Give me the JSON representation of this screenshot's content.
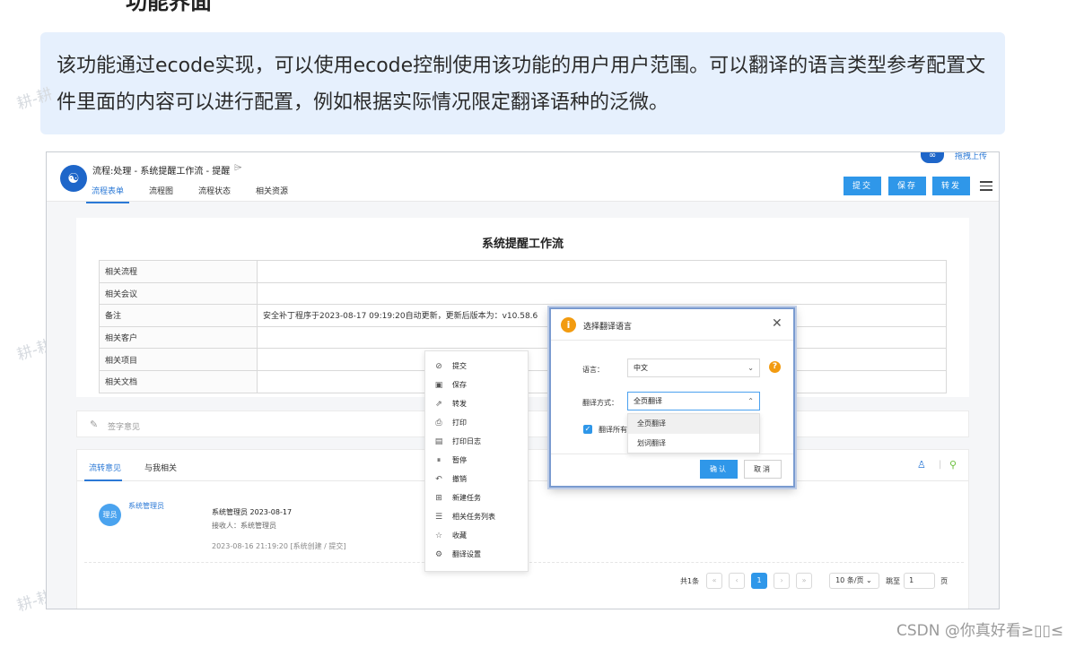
{
  "doc": {
    "heading_clip": "功能界面",
    "callout": "该功能通过ecode实现，可以使用ecode控制使用该功能的用户用户范围。可以翻译的语言类型参考配置文件里面的内容可以进行配置，例如根据实际情况限定翻译语种的泛微。",
    "watermark": "耕-耕",
    "csdn_credit": "CSDN @你真好看≥▯▯≤"
  },
  "header": {
    "logo": "☯",
    "title": "流程:处理 - 系统提醒工作流 - 提醒",
    "tag_icon": "⌲",
    "upload_icon": "∞",
    "upload_text": "拖拽上传",
    "tabs": [
      {
        "label": "流程表单"
      },
      {
        "label": "流程图"
      },
      {
        "label": "流程状态"
      },
      {
        "label": "相关资源"
      }
    ],
    "buttons": {
      "submit": "提交",
      "save": "保存",
      "forward": "转发"
    }
  },
  "form": {
    "title": "系统提醒工作流",
    "rows": [
      {
        "label": "相关流程",
        "value": ""
      },
      {
        "label": "相关会议",
        "value": ""
      },
      {
        "label": "备注",
        "value": "安全补丁程序于2023-08-17 09:19:20自动更新，更新后版本为：v10.58.6"
      },
      {
        "label": "相关客户",
        "value": ""
      },
      {
        "label": "相关项目",
        "value": ""
      },
      {
        "label": "相关文档",
        "value": ""
      }
    ]
  },
  "sign": {
    "icon": "✎",
    "placeholder": "签字意见"
  },
  "comments": {
    "tabs": [
      {
        "label": "流转意见"
      },
      {
        "label": "与我相关"
      }
    ],
    "tools": {
      "person_icon": "♙",
      "sep": "|",
      "search_icon": "⚲"
    },
    "entry": {
      "avatar": "理员",
      "user": "系统管理员",
      "title": "系统管理员 2023-08-17",
      "receiver": "接收人：系统管理员",
      "date": "2023-08-16 21:19:20   [系统创建 / 提交]"
    },
    "pager": {
      "total": "共1条",
      "first": "«",
      "prev": "‹",
      "page": "1",
      "next": "›",
      "last": "»",
      "page_size": "10 条/页 ⌄",
      "jump_label": "跳至",
      "jump_value": "1",
      "unit": "页"
    }
  },
  "context_menu": {
    "items": [
      {
        "icon": "⊘",
        "label": "提交"
      },
      {
        "icon": "▣",
        "label": "保存"
      },
      {
        "icon": "⇗",
        "label": "转发"
      },
      {
        "icon": "⎙",
        "label": "打印"
      },
      {
        "icon": "▤",
        "label": "打印日志"
      },
      {
        "icon": "⏸",
        "label": "暂停"
      },
      {
        "icon": "↶",
        "label": "撤销"
      },
      {
        "icon": "⊞",
        "label": "新建任务"
      },
      {
        "icon": "☰",
        "label": "相关任务列表"
      },
      {
        "icon": "☆",
        "label": "收藏"
      },
      {
        "icon": "⚙",
        "label": "翻译设置"
      }
    ]
  },
  "dialog": {
    "title": "选择翻译语言",
    "info_icon": "i",
    "close": "✕",
    "language_label": "语言：",
    "language_value": "中文",
    "help_icon": "?",
    "mode_label": "翻译方式：",
    "mode_value": "全页翻译",
    "chevron_down": "⌄",
    "chevron_up": "⌃",
    "checkbox_mark": "✓",
    "checkbox_label": "翻译所有",
    "options": [
      "全页翻译",
      "划词翻译"
    ],
    "ok": "确认",
    "cancel": "取消"
  }
}
